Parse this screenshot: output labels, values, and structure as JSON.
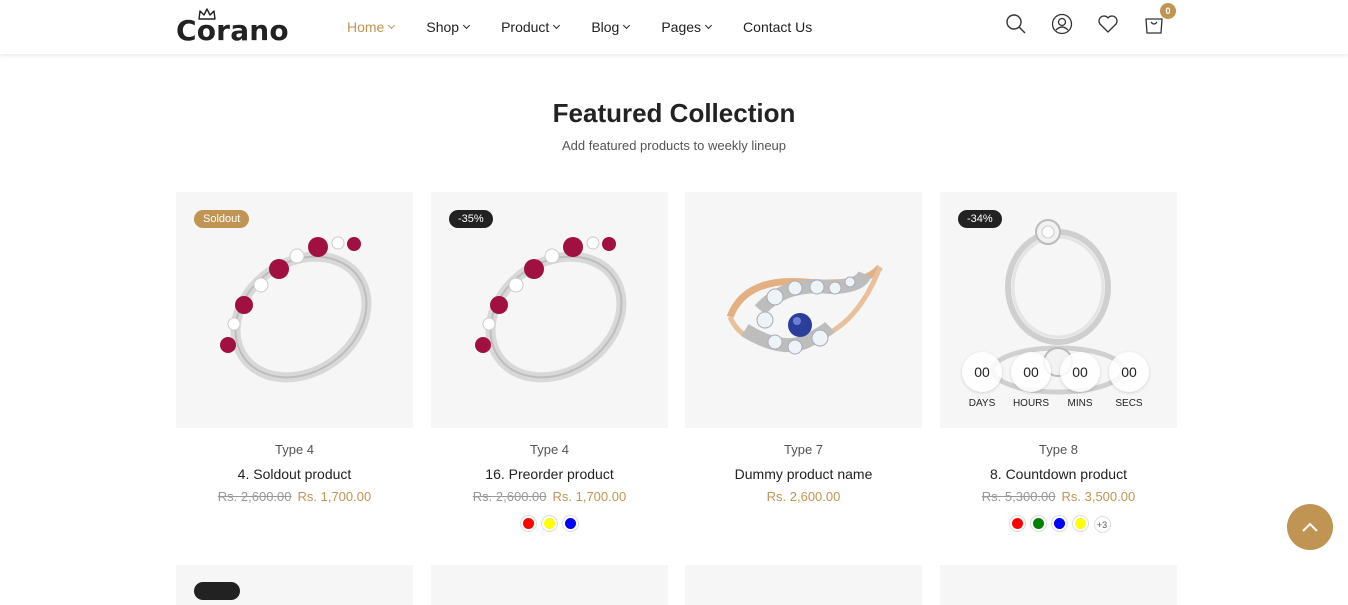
{
  "header": {
    "logo_text": "Corano",
    "nav": [
      {
        "label": "Home",
        "active": true,
        "dropdown": true
      },
      {
        "label": "Shop",
        "active": false,
        "dropdown": true
      },
      {
        "label": "Product",
        "active": false,
        "dropdown": true
      },
      {
        "label": "Blog",
        "active": false,
        "dropdown": true
      },
      {
        "label": "Pages",
        "active": false,
        "dropdown": true
      },
      {
        "label": "Contact Us",
        "active": false,
        "dropdown": false
      }
    ],
    "icons": [
      "search-icon",
      "account-icon",
      "wishlist-icon",
      "cart-icon"
    ],
    "cart_count": "0"
  },
  "section": {
    "title": "Featured Collection",
    "subtitle": "Add featured products to weekly lineup"
  },
  "products": [
    {
      "type": "Type 4",
      "name": "4. Soldout product",
      "old_price": "Rs. 2,600.00",
      "price": "Rs. 1,700.00",
      "label": "Soldout",
      "image": "ruby-ring"
    },
    {
      "type": "Type 4",
      "name": "16. Preorder product",
      "old_price": "Rs. 2,600.00",
      "price": "Rs. 1,700.00",
      "label": "-35%",
      "image": "ruby-ring",
      "swatches": [
        "#ff0000",
        "#ffff00",
        "#0000ff"
      ]
    },
    {
      "type": "Type 7",
      "name": "Dummy product name",
      "old_price": "",
      "price": "Rs. 2,600.00",
      "label": "",
      "image": "sapphire-ring"
    },
    {
      "type": "Type 8",
      "name": "8. Countdown product",
      "old_price": "Rs. 5,300.00",
      "price": "Rs. 3,500.00",
      "label": "-34%",
      "image": "diamond-ring-set",
      "swatches": [
        "#ff0000",
        "#008000",
        "#0000ff",
        "#ffff00"
      ],
      "more_swatches": "+3",
      "countdown": [
        {
          "value": "00",
          "unit": "DAYS"
        },
        {
          "value": "00",
          "unit": "HOURS"
        },
        {
          "value": "00",
          "unit": "MINS"
        },
        {
          "value": "00",
          "unit": "SECS"
        }
      ]
    }
  ],
  "colors": {
    "accent": "#c09553",
    "dark": "#222222",
    "card_bg": "#f6f6f6"
  }
}
